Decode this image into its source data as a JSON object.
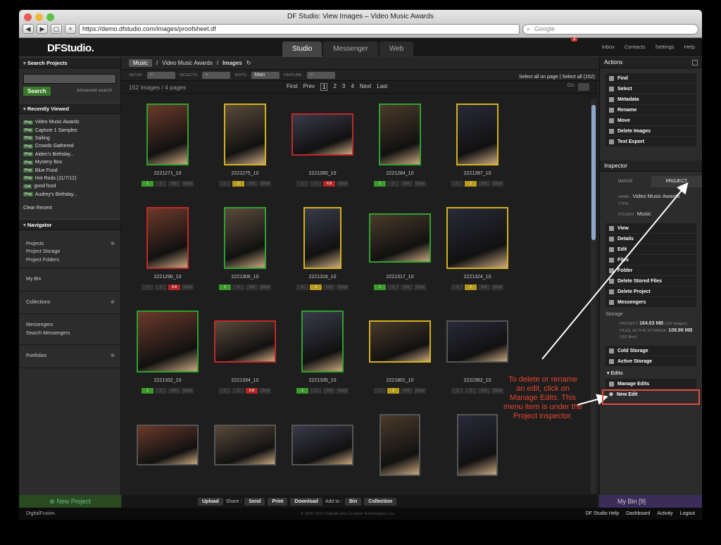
{
  "browser": {
    "title": "DF Studio: View Images – Video Music Awards",
    "url": "https://demo.dfstudio.com/images/proofsheet.df",
    "search_placeholder": "Google"
  },
  "app": {
    "logo": "DFStudio.",
    "tabs": [
      "Studio",
      "Messenger",
      "Web"
    ],
    "active_tab": "Studio",
    "top_links": [
      "Inbox",
      "Contacts",
      "Settings",
      "Help"
    ],
    "inbox_count": "3"
  },
  "left": {
    "search_header": "Search Projects",
    "search_button": "Search",
    "advanced": "Advanced search",
    "recent_header": "Recently Viewed",
    "recent": [
      {
        "tag": "Proj",
        "name": "Video Music Awards"
      },
      {
        "tag": "Proj",
        "name": "Capture 1 Samples"
      },
      {
        "tag": "Proj",
        "name": "Sailing"
      },
      {
        "tag": "Proj",
        "name": "Crowds Gathered"
      },
      {
        "tag": "Proj",
        "name": "Aiden's Birthday..."
      },
      {
        "tag": "Proj",
        "name": "Mystery Box"
      },
      {
        "tag": "Proj",
        "name": "Blue Food"
      },
      {
        "tag": "Proj",
        "name": "Hot Rods (11/7/12)"
      },
      {
        "tag": "Col",
        "name": "good food"
      },
      {
        "tag": "Proj",
        "name": "Audrey's Birthday..."
      }
    ],
    "clear_recent": "Clear Recent",
    "navigator_header": "Navigator",
    "nav_projects": "Projects",
    "nav_storage": "Project Storage",
    "nav_folders": "Project Folders",
    "my_bin": "My Bin",
    "collections": "Collections",
    "messengers": "Messengers",
    "search_messengers": "Search Messengers",
    "portfolios": "Portfolios",
    "new_project": "New Project"
  },
  "center": {
    "crumb_root": "Music",
    "crumb_project": "Video Music Awards",
    "crumb_current": "Images",
    "setup_label": "SETUP:",
    "selects_label": "SELECTS:",
    "edits_label": "EDITS:",
    "edits_value": "Main",
    "feature_label": "FEATURE:",
    "dash": "--",
    "select_all_page": "Select all on page",
    "select_all": "Select all (152)",
    "count_text": "152 images / 4 pages",
    "first": "First",
    "prev": "Prev",
    "pages": [
      "1",
      "2",
      "3",
      "4"
    ],
    "next": "Next",
    "last": "Last",
    "goto": "Go:",
    "images": [
      {
        "id": "2221271_10",
        "border": "green",
        "state": "1"
      },
      {
        "id": "2221275_10",
        "border": "yellow",
        "state": "2"
      },
      {
        "id": "2221280_10",
        "border": "red",
        "state": "kill"
      },
      {
        "id": "2221284_10",
        "border": "green",
        "state": "1"
      },
      {
        "id": "2221287_10",
        "border": "yellow",
        "state": "2"
      },
      {
        "id": "2221290_10",
        "border": "red",
        "state": "kill"
      },
      {
        "id": "2221306_10",
        "border": "green",
        "state": "1"
      },
      {
        "id": "2221316_10",
        "border": "yellow",
        "state": "2"
      },
      {
        "id": "2221317_10",
        "border": "green",
        "state": "1"
      },
      {
        "id": "2221324_10",
        "border": "yellow",
        "state": "2"
      },
      {
        "id": "2221332_10",
        "border": "green",
        "state": "1"
      },
      {
        "id": "2221334_10",
        "border": "red",
        "state": "kill"
      },
      {
        "id": "2221335_10",
        "border": "green",
        "state": "1"
      },
      {
        "id": "2221801_10",
        "border": "yellow",
        "state": "2"
      },
      {
        "id": "2222362_10",
        "border": "gray",
        "state": "none"
      },
      {
        "id": "",
        "border": "gray",
        "state": "none"
      },
      {
        "id": "",
        "border": "gray",
        "state": "none"
      },
      {
        "id": "",
        "border": "gray",
        "state": "none"
      },
      {
        "id": "",
        "border": "gray",
        "state": "none"
      },
      {
        "id": "",
        "border": "gray",
        "state": "none"
      }
    ],
    "btn_labels": [
      "1",
      "2",
      "Kill",
      "Clear"
    ],
    "bottom": {
      "upload": "Upload",
      "share": "Share :",
      "send": "Send",
      "print": "Print",
      "download": "Download",
      "add_to": "Add to :",
      "bin": "Bin",
      "collection": "Collection"
    }
  },
  "right": {
    "actions_header": "Actions",
    "actions": [
      "Find",
      "Select",
      "Metadata",
      "Rename",
      "Move",
      "Delete Images",
      "Text Export"
    ],
    "inspector_header": "Inspector",
    "tab_image": "IMAGE",
    "tab_project": "PROJECT",
    "name_label": "NAME :",
    "name_value": "Video Music Awards",
    "type_label": "TYPE :",
    "folder_label": "FOLDER :",
    "folder_value": "Music",
    "project_actions": [
      "View",
      "Details",
      "Edit",
      "Files",
      "Folder",
      "Delete Stored Files",
      "Delete Project",
      "Messengers"
    ],
    "storage_header": "Storage",
    "project_label": "PROJECT:",
    "project_value": "164.63 MB",
    "project_count": "(152 images)",
    "files_label": "FILES, ACTIVE STORAGE:",
    "files_value": "108.96 MB",
    "files_count": "(152 files)",
    "storage_actions": [
      "Cold Storage",
      "Active Storage"
    ],
    "edits_header": "Edits",
    "manage_edits": "Manage Edits",
    "new_edit": "New Edit",
    "my_bin": "My Bin",
    "bin_count": "9"
  },
  "footer": {
    "brand": "DigitalFusion.",
    "copyright": "© 2000–2013 DigitalFusion Creative Technologies, Inc.",
    "links": [
      "DF Studio Help",
      "Dashboard",
      "Activity",
      "Logout"
    ]
  },
  "annotation": "To delete or rename an edit, click on Manage Edits. This menu item is under the Project inspector.",
  "colors": {
    "green": "#2fa02f",
    "yellow": "#d2b21b",
    "red": "#c0282b",
    "annotation": "#e4442f"
  }
}
